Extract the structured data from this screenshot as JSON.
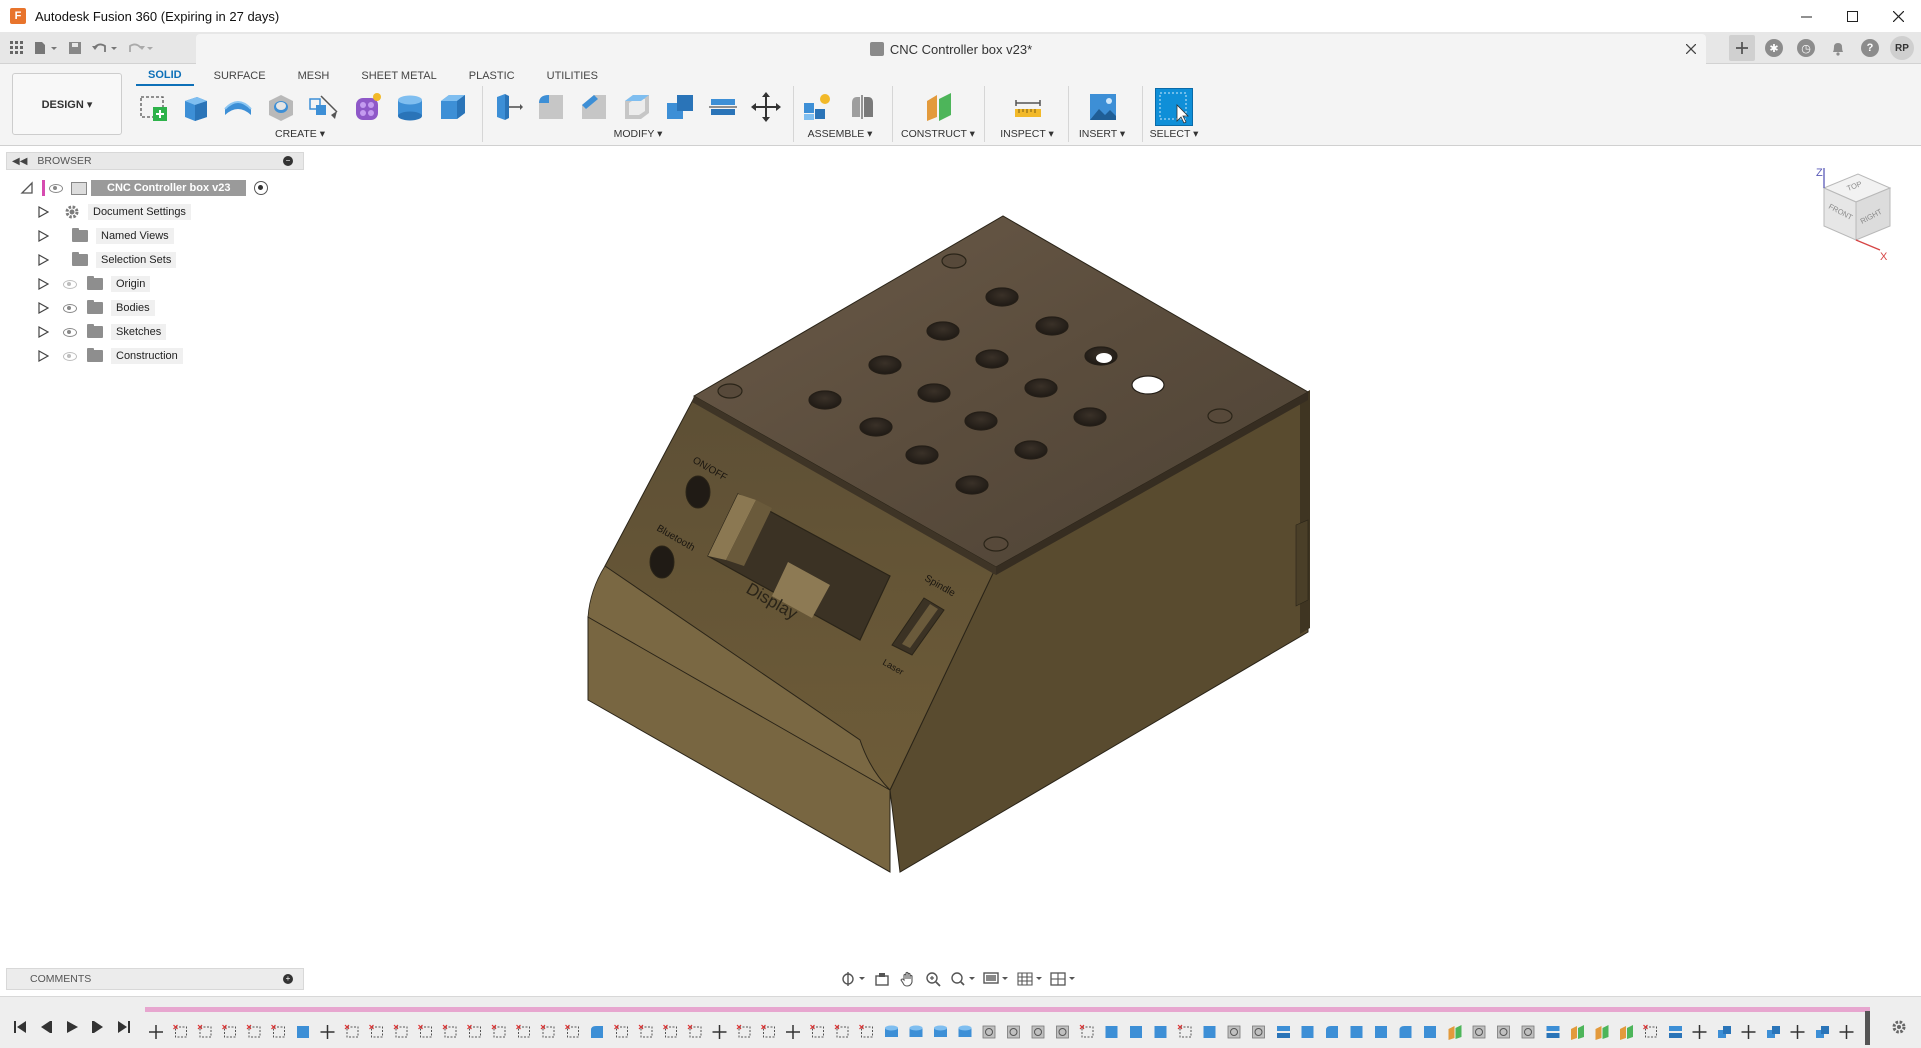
{
  "window": {
    "title": "Autodesk Fusion 360 (Expiring in 27 days)",
    "minimize_icon": "minimize-icon",
    "maximize_icon": "maximize-icon",
    "close_icon": "close-icon"
  },
  "document": {
    "tab_title": "CNC Controller box v23*",
    "user_initials": "RP"
  },
  "toolbar": {
    "workspace_label": "DESIGN ▾",
    "tabs": [
      {
        "label": "SOLID",
        "active": true
      },
      {
        "label": "SURFACE",
        "active": false
      },
      {
        "label": "MESH",
        "active": false
      },
      {
        "label": "SHEET METAL",
        "active": false
      },
      {
        "label": "PLASTIC",
        "active": false
      },
      {
        "label": "UTILITIES",
        "active": false
      }
    ],
    "groups": {
      "create": "CREATE ▾",
      "modify": "MODIFY ▾",
      "assemble": "ASSEMBLE ▾",
      "construct": "CONSTRUCT ▾",
      "inspect": "INSPECT ▾",
      "insert": "INSERT ▾",
      "select": "SELECT ▾"
    }
  },
  "browser": {
    "title": "BROWSER",
    "root": "CNC Controller box v23",
    "items": [
      {
        "label": "Document Settings",
        "icon": "gear-icon",
        "visible": null
      },
      {
        "label": "Named Views",
        "icon": "folder-icon",
        "visible": null
      },
      {
        "label": "Selection Sets",
        "icon": "folder-icon",
        "visible": null
      },
      {
        "label": "Origin",
        "icon": "folder-icon",
        "visible": false
      },
      {
        "label": "Bodies",
        "icon": "folder-icon",
        "visible": true
      },
      {
        "label": "Sketches",
        "icon": "folder-icon",
        "visible": true
      },
      {
        "label": "Construction",
        "icon": "folder-icon",
        "visible": false
      }
    ]
  },
  "comments": {
    "title": "COMMENTS"
  },
  "model": {
    "labels": {
      "onoff": "ON/OFF",
      "bluetooth": "Bluetooth",
      "display": "Display",
      "spindle": "Spindle",
      "laser": "Laser"
    }
  },
  "viewcube": {
    "top": "TOP",
    "front": "FRONT",
    "right": "RIGHT",
    "z_axis": "Z",
    "x_axis": "X"
  },
  "colors": {
    "accent": "#0d70b8",
    "model_top": "#5f5040",
    "model_side": "#6b5a38",
    "timeline_progress": "#e7a6cf"
  }
}
